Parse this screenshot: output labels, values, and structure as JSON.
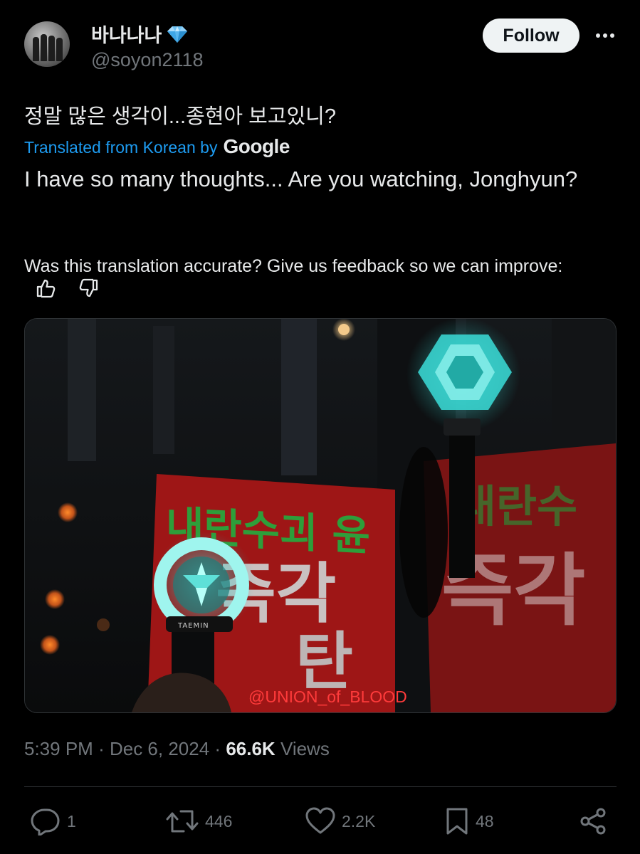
{
  "user": {
    "display_name": "바나나나",
    "verified_icon": "blue-diamond-icon",
    "handle": "@soyon2118",
    "follow_label": "Follow"
  },
  "tweet": {
    "text_korean": "정말 많은 생각이...종현아 보고있니?",
    "translated_prefix": "Translated from Korean by",
    "translator": "Google",
    "translation": "I have so many thoughts... Are you watching, Jonghyun?",
    "feedback_text": "Was this translation accurate? Give us feedback so we can improve:"
  },
  "media": {
    "watermark": "@UNION_of_BLOOD",
    "sign_text_1": "내란수괴 윤",
    "sign_text_2": "즉각",
    "sign_text_3": "탄",
    "sign_text_right_1": "내란수",
    "sign_text_right_2": "즉각",
    "lightstick_label": "TAEMIN"
  },
  "meta": {
    "time": "5:39 PM",
    "separator": "·",
    "date": "Dec 6, 2024",
    "views_count": "66.6K",
    "views_label": "Views"
  },
  "actions": {
    "replies": "1",
    "reposts": "446",
    "likes": "2.2K",
    "bookmarks": "48"
  },
  "colors": {
    "background": "#000000",
    "link": "#1d9bf0",
    "muted": "#71767b",
    "text": "#e7e9ea"
  }
}
